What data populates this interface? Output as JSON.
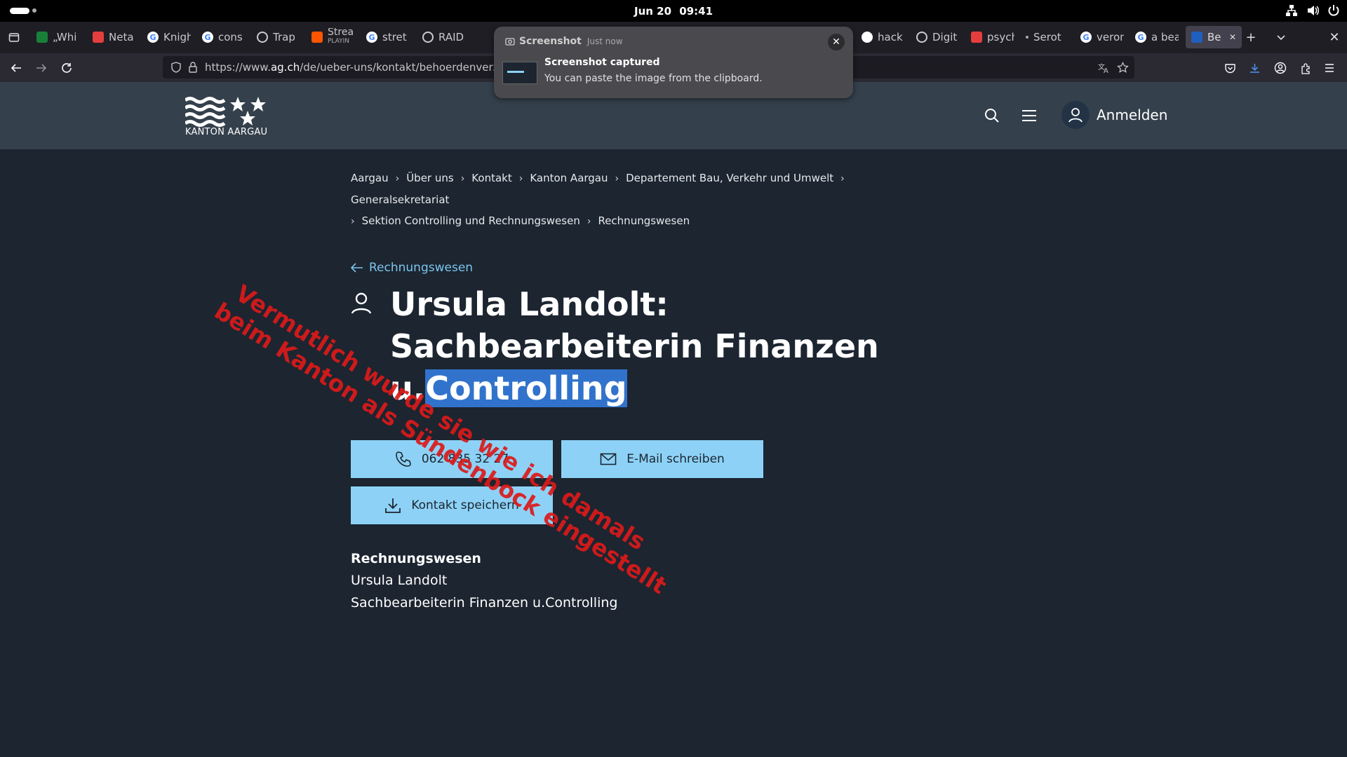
{
  "topbar": {
    "date": "Jun 20",
    "time": "09:41"
  },
  "tabs": [
    {
      "label": "„Whi",
      "favicon": "google-sheets-icon",
      "color": "#188038"
    },
    {
      "label": "Neta",
      "favicon": "pocket-icon",
      "color": "#e53e3e"
    },
    {
      "label": "Knigh",
      "favicon": "google-icon",
      "color": "#ffffff"
    },
    {
      "label": "cons",
      "favicon": "google-icon",
      "color": "#ffffff"
    },
    {
      "label": "Trap",
      "favicon": "globe-icon",
      "color": "#ffffff"
    },
    {
      "label": "Strea",
      "sublabel": "PLAYIN",
      "favicon": "soundcloud-icon",
      "color": "#ff5500"
    },
    {
      "label": "stret",
      "favicon": "google-icon",
      "color": "#ffffff"
    },
    {
      "label": "RAID",
      "favicon": "globe-icon",
      "color": "#ffffff"
    },
    {
      "label": "hack",
      "favicon": "github-icon",
      "color": "#ffffff"
    },
    {
      "label": "Digit",
      "favicon": "globe-icon",
      "color": "#ffffff"
    },
    {
      "label": "psych",
      "favicon": "pdf-icon",
      "color": "#e53e3e"
    },
    {
      "label": "Serot",
      "favicon": "dot-icon",
      "color": "#aaaaaa"
    },
    {
      "label": "veron",
      "favicon": "google-icon",
      "color": "#ffffff"
    },
    {
      "label": "a bea",
      "favicon": "google-icon",
      "color": "#ffffff"
    },
    {
      "label": "Be",
      "favicon": "kanton-aargau-icon",
      "color": "#1f5fbf",
      "active": true
    }
  ],
  "url": {
    "prefix": "https://www.",
    "domain": "ag.ch",
    "path": "/de/ueber-uns/kontakt/behoerdenverzeic"
  },
  "notification": {
    "app": "Screenshot",
    "when": "Just now",
    "title": "Screenshot captured",
    "body": "You can paste the image from the clipboard."
  },
  "site": {
    "logo_text": "KANTON AARGAU",
    "login_label": "Anmelden"
  },
  "breadcrumb": [
    "Aargau",
    "Über uns",
    "Kontakt",
    "Kanton Aargau",
    "Departement Bau, Verkehr und Umwelt",
    "Generalsekretariat",
    "Sektion Controlling und Rechnungswesen",
    "Rechnungswesen"
  ],
  "back_link": "Rechnungswesen",
  "title": {
    "main": "Ursula Landolt: Sachbearbeiterin Finanzen u.",
    "highlighted": "Controlling"
  },
  "buttons": {
    "phone": "062 835 32 27",
    "email": "E-Mail schreiben",
    "save": "Kontakt speichern"
  },
  "org": {
    "heading": "Rechnungswesen",
    "name": "Ursula Landolt",
    "role": "Sachbearbeiterin Finanzen u.Controlling"
  },
  "overlay": {
    "line1": "Vermutlich wurde sie wie ich damals",
    "line2": "beim Kanton als Sündenbock eingestellt",
    "color": "#dc1a1a"
  },
  "colors": {
    "page_bg": "#1c2530",
    "header_bg": "#34404c",
    "button_bg": "#8dd2f6",
    "link": "#7cc4ee",
    "selection": "#3173cc"
  }
}
